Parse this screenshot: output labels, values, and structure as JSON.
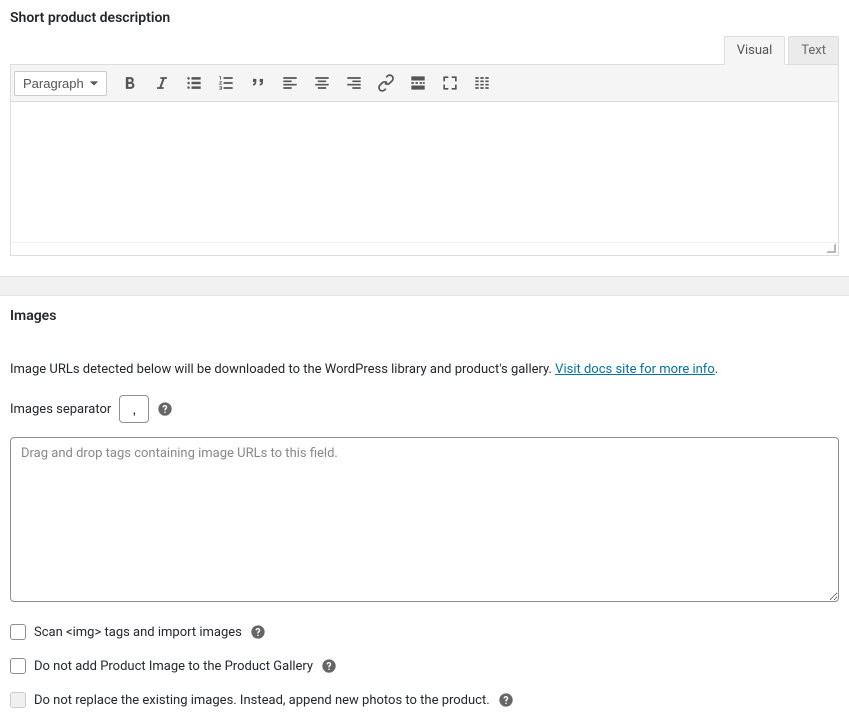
{
  "shortDescription": {
    "title": "Short product description",
    "tabs": {
      "visual": "Visual",
      "text": "Text"
    },
    "formatDropdown": "Paragraph"
  },
  "images": {
    "title": "Images",
    "infoText": "Image URLs detected below will be downloaded to the WordPress library and product's gallery. ",
    "infoLink": "Visit docs site for more info",
    "infoPeriod": ".",
    "separatorLabel": "Images separator",
    "separatorValue": ",",
    "textareaPlaceholder": "Drag and drop tags containing image URLs to this field.",
    "checkbox1": "Scan <img> tags and import images",
    "checkbox2": "Do not add Product Image to the Product Gallery",
    "checkbox3": "Do not replace the existing images. Instead, append new photos to the product."
  }
}
